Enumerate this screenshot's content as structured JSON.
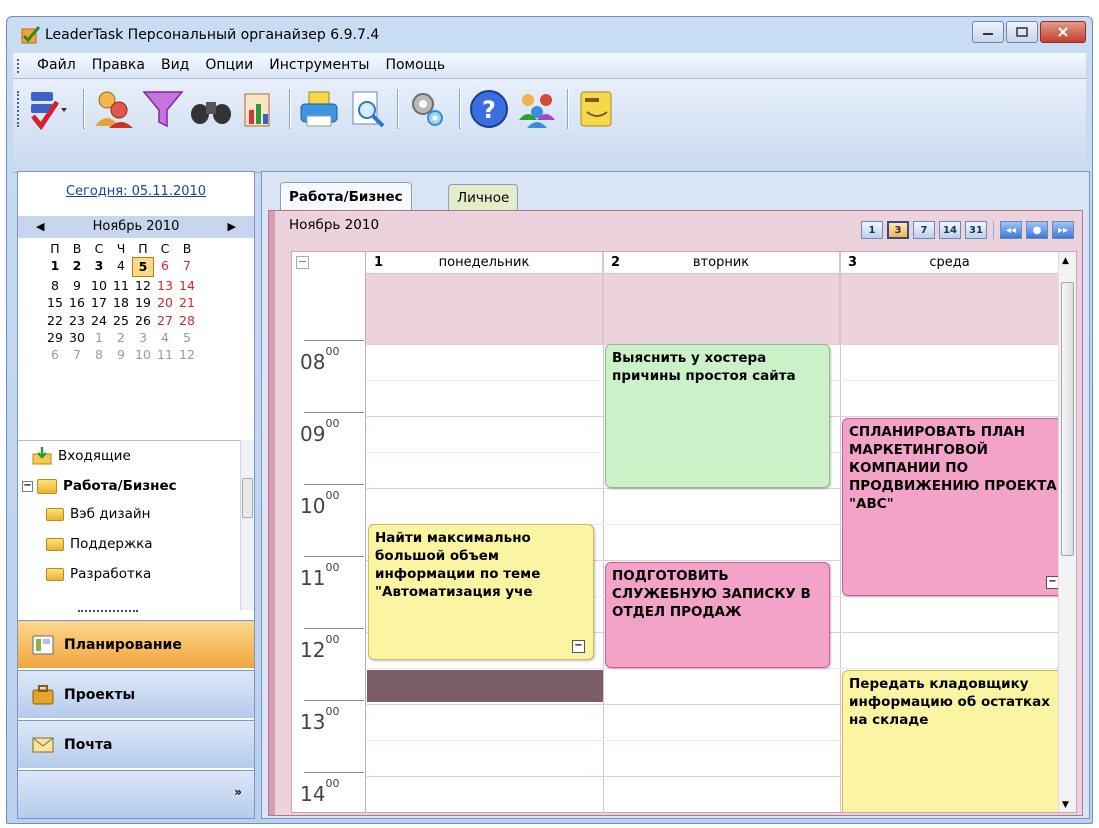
{
  "window": {
    "title": "LeaderTask Персональный органайзер 6.9.7.4"
  },
  "menu": {
    "items": [
      "Файл",
      "Правка",
      "Вид",
      "Опции",
      "Инструменты",
      "Помощь"
    ]
  },
  "toolbar": {
    "icons": [
      "new-task-icon",
      "users-icon",
      "filter-icon",
      "binoculars-icon",
      "report-icon",
      "print-icon",
      "preview-icon",
      "settings-icon",
      "help-icon",
      "people-icon",
      "sticker-icon"
    ]
  },
  "left": {
    "today": "Сегодня: 05.11.2010",
    "month": "Ноябрь 2010",
    "weekdays": [
      "П",
      "В",
      "С",
      "Ч",
      "П",
      "С",
      "В"
    ],
    "weeks": [
      [
        "1",
        "2",
        "3",
        "4",
        "5",
        "6",
        "7"
      ],
      [
        "8",
        "9",
        "10",
        "11",
        "12",
        "13",
        "14"
      ],
      [
        "15",
        "16",
        "17",
        "18",
        "19",
        "20",
        "21"
      ],
      [
        "22",
        "23",
        "24",
        "25",
        "26",
        "27",
        "28"
      ],
      [
        "29",
        "30",
        "1",
        "2",
        "3",
        "4",
        "5"
      ],
      [
        "6",
        "7",
        "8",
        "9",
        "10",
        "11",
        "12"
      ]
    ],
    "tree": [
      {
        "label": "Входящие",
        "level": 0
      },
      {
        "label": "Работа/Бизнес",
        "level": 0
      },
      {
        "label": "Вэб дизайн",
        "level": 1
      },
      {
        "label": "Поддержка",
        "level": 1
      },
      {
        "label": "Разработка",
        "level": 1
      }
    ],
    "nav": [
      "Планирование",
      "Проекты",
      "Почта"
    ],
    "more": "»"
  },
  "right": {
    "tabs": [
      "Работа/Бизнес",
      "Личное"
    ],
    "month_label": "Ноябрь 2010",
    "view_buttons": [
      "1",
      "3",
      "7",
      "14",
      "31"
    ],
    "days": [
      {
        "num": "1",
        "name": "понедельник"
      },
      {
        "num": "2",
        "name": "вторник"
      },
      {
        "num": "3",
        "name": "среда"
      }
    ],
    "hours": [
      {
        "h": "08",
        "m": "00"
      },
      {
        "h": "09",
        "m": "00"
      },
      {
        "h": "10",
        "m": "00"
      },
      {
        "h": "11",
        "m": "00"
      },
      {
        "h": "12",
        "m": "00"
      },
      {
        "h": "13",
        "m": "00"
      },
      {
        "h": "14",
        "m": "00"
      }
    ],
    "events": [
      {
        "text": "Выяснить у хостера причины простоя сайта",
        "color": "#ccf0c8"
      },
      {
        "text": "Найти максимально большой объем информации по теме \"Автоматизация уче",
        "color": "#fbf4a2"
      },
      {
        "text": "ПОДГОТОВИТЬ СЛУЖЕБНУЮ ЗАПИСКУ В ОТДЕЛ ПРОДАЖ",
        "color": "#f3a2c8"
      },
      {
        "text": "СПЛАНИРОВАТЬ ПЛАН МАРКЕТИНГОВОЙ КОМПАНИИ ПО ПРОДВИЖЕНИЮ ПРОЕКТА \"АВС\"",
        "color": "#f3a2c8"
      },
      {
        "text": "Передать кладовщику информацию об остатках на складе",
        "color": "#fbf4a2"
      }
    ]
  }
}
